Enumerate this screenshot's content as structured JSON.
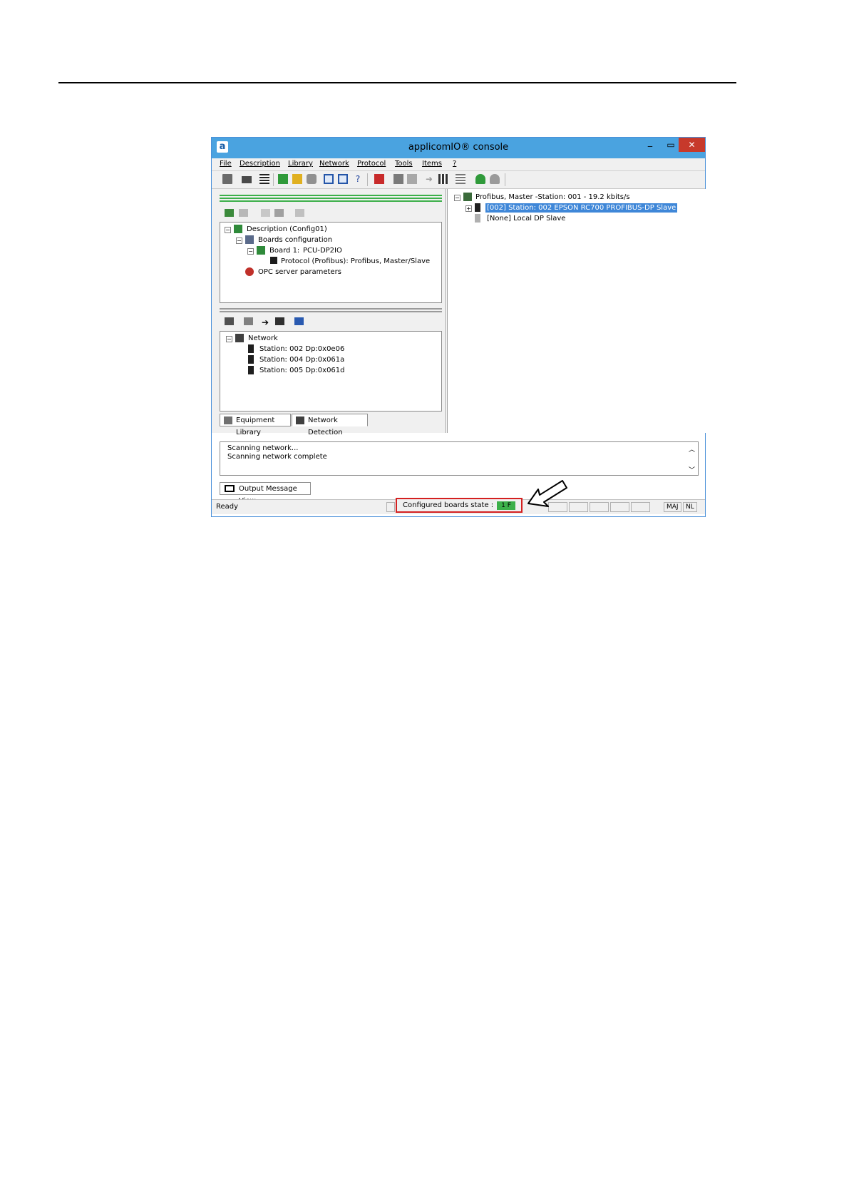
{
  "window": {
    "title": "applicomIO® console",
    "logo_letter": "a",
    "controls": {
      "minimize": "‒",
      "maximize": "▭",
      "close": "✕"
    }
  },
  "menu": [
    "File",
    "Description",
    "Library",
    "Network",
    "Protocol",
    "Tools",
    "Items",
    "?"
  ],
  "toolbar_icons": [
    "save-icon",
    "print-icon",
    "transfer-icon",
    "flag-icon",
    "table-icon",
    "camera-icon",
    "view-left-icon",
    "view-right-icon",
    "help-icon",
    "red-book-icon",
    "download-icon",
    "upload-icon",
    "arrow-right-icon",
    "grid-icon",
    "list-icon",
    "green-device-icon",
    "grey-device-icon"
  ],
  "description_tree": {
    "root": "Description (Config01)",
    "boards": "Boards configuration",
    "board": "Board 1:",
    "board_name": "PCU-DP2IO",
    "protocol": "Protocol (Profibus): Profibus, Master/Slave",
    "opc": "OPC server parameters"
  },
  "network_tree": {
    "root": "Network",
    "stations": [
      "Station: 002  Dp:0x0e06",
      "Station: 004  Dp:0x061a",
      "Station: 005  Dp:0x061d"
    ]
  },
  "left_tabs": {
    "equipment": "Equipment Library",
    "detection": "Network Detection"
  },
  "right_tree": {
    "root": "Profibus, Master -Station: 001 - 19.2 kbits/s",
    "selected": "[002] Station: 002  EPSON RC700 PROFIBUS-DP Slave",
    "local": "[None] Local DP Slave"
  },
  "output": {
    "lines": [
      "Scanning network...",
      "Scanning  network complete"
    ],
    "tab": "Output Message View"
  },
  "status": {
    "ready": "Ready",
    "boards_label": "Configured boards state :",
    "boards_value": "1 F",
    "maj": "MAJ",
    "nl": "NL"
  },
  "colors": {
    "titlebar": "#4aa3e0",
    "close_button": "#c7392b",
    "selection": "#3f87d8",
    "ok_green": "#3cb04a",
    "highlight_box": "#d42020"
  }
}
